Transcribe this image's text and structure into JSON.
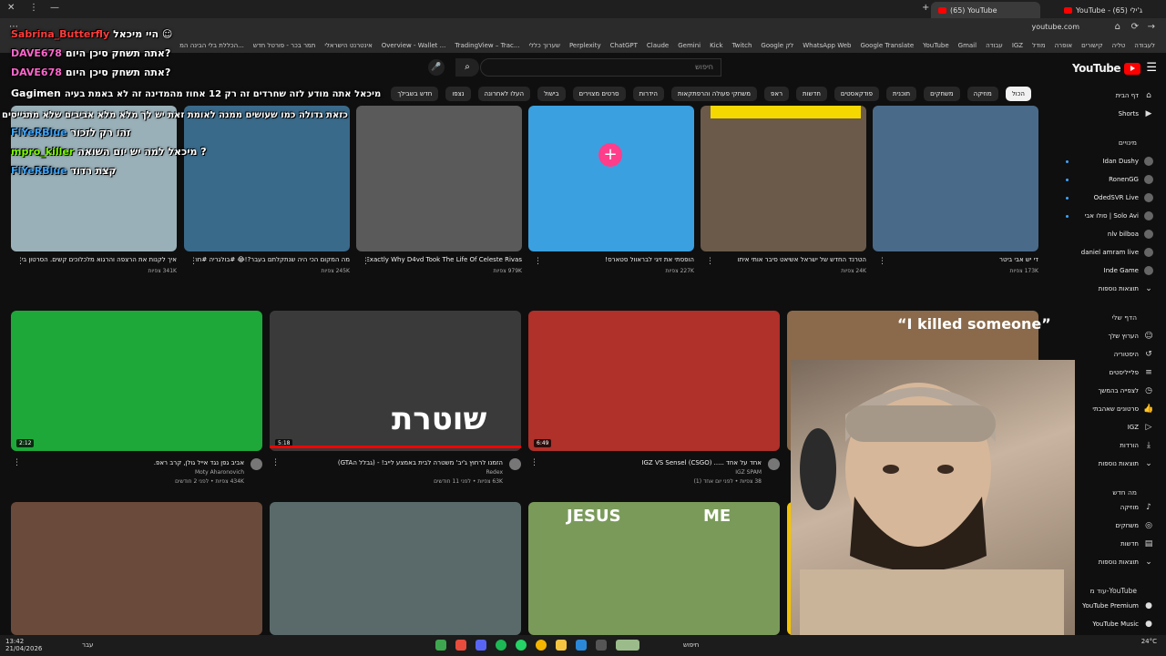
{
  "browser": {
    "tabs": [
      {
        "label": "(65) YouTube",
        "active": true
      },
      {
        "label": "YouTube - (65) ג'ילי",
        "active": false
      }
    ],
    "url": "youtube.com",
    "bookmarks": [
      "לעבודה",
      "טליה",
      "קישורים",
      "אופרה",
      "מודל",
      "IGZ",
      "עבודה",
      "Gmail",
      "YouTube",
      "Google Translate",
      "WhatsApp Web",
      "Google לק",
      "Twitch",
      "Kick",
      "Gemini",
      "Claude",
      "ChatGPT",
      "Perplexity",
      "שערוך כללי",
      "TradingView – Trac...",
      "Overview - Wallet ...",
      "אינטרנט הישראלי",
      "תמר בכר - פורטל חדש",
      "הכללת בלי הבינה המ..."
    ]
  },
  "header": {
    "logo": "YouTube",
    "search_placeholder": "חיפוש"
  },
  "chips": [
    "הכול",
    "מוזיקה",
    "משחקים",
    "תוכנית",
    "פודקאסטים",
    "חדשות",
    "ראפ",
    "משחקי פעולה והרפתקאות",
    "הידרות",
    "סרטים מצוירים",
    "בישול",
    "העלו לאחרונה",
    "נצפו",
    "חדש בשבילך"
  ],
  "sidebar": {
    "home": "דף הבית",
    "shorts": "Shorts",
    "subs_title": "מינויים",
    "subs": [
      "Idan Dushy",
      "RonenGG",
      "OdedSVR Live",
      "Solo Avi | סולו אבי",
      "nlv bilboa",
      "daniel amram live",
      "Inde Game"
    ],
    "show_more": "תוצאות נוספות",
    "you_title": "הדף שלי",
    "you_items": [
      "הערוץ שלך",
      "היסטוריה",
      "פלייליסטים",
      "לצפייה בהמשך",
      "סרטונים שאהבתי",
      "IGZ",
      "הורדות"
    ],
    "show_more2": "תוצאות נוספות",
    "explore_title": "מה חדש",
    "explore_items": [
      "מוזיקה",
      "משחקים",
      "חדשות"
    ],
    "show_more3": "תוצאות נוספות",
    "more_title": "עוד מ-YouTube",
    "more_items": [
      "YouTube Premium",
      "YouTube Music"
    ]
  },
  "videos_row1": [
    {
      "title": "די יש אבי ביטר",
      "meta": "173K צפיות"
    },
    {
      "title": "הטרנד החדש של ישראל אשיאט סיבר אותי איתו",
      "meta": "24K צפיות"
    },
    {
      "title": "הופסתי את זיגי לבראוול סטארס!",
      "meta": "227K צפיות"
    },
    {
      "title": "We Finally Know Exactly Why D4vd Took The Life Of Celeste Rivas",
      "meta": "979K צפיות"
    },
    {
      "title": "מה המקום הכי היה שנתקלתם בעבר?!😂 #בולגריה #חול #טוב bulgaria# #שעארמה",
      "meta": "245K צפיות"
    },
    {
      "title": "איך לקנות את הרצפה והרגוא מלכלוכים קשים. הסרטון בשיתוף #ינקרי #המרקטר #בקיון #מלכודר...",
      "meta": "341K צפיות"
    }
  ],
  "videos_row2": [
    {
      "title": "Murder To Chat GPT",
      "channel": "Out of context Clips",
      "meta": "6.4K צפיות • לפני 9 חודשים",
      "duration": "4:15"
    },
    {
      "title": "אחד על אחד ..... IGZ VS Sensel (CSGO)",
      "channel": "IGZ SPAM",
      "meta": "38 צפיות • לפני יום אחד (1)",
      "duration": "6:49"
    },
    {
      "title": "הזמנו לרחוץ ג'יב' משטרה לבית באמצע לייב! - (גבלל הGTA)",
      "channel": "Redex",
      "meta": "63K צפיות • לפני 11 חודשים",
      "duration": "5:18"
    },
    {
      "title": "אביב גפן נגד אייל גולן, קרב ראפ.",
      "channel": "Moty Aharonovich",
      "meta": "434K צפיות • לפני 2 חודשים",
      "duration": "2:12"
    }
  ],
  "thumb_texts": {
    "killed": "“I killed someone”",
    "shoteret": "שוטרת",
    "jesus": "JESUS",
    "me": "ME"
  },
  "chat": [
    {
      "user": "Sabrina_Butterfly",
      "msg": "היי מיכאל ☺",
      "color": "#ff3b3b"
    },
    {
      "user": "DAVE678",
      "msg": "אתה תשחק סיכן היום?",
      "color": "#ff66cc"
    },
    {
      "user": "DAVE678",
      "msg": "אתה תשחק סיכן היום?",
      "color": "#ff66cc"
    },
    {
      "user": "Gagimen",
      "msg": "מיכאל אתה מודע לזה שחרדים זה רק 12 אחוז מהמדינה זה לא באמת בעיה",
      "color": "#ffffff"
    },
    {
      "user": "",
      "msg": "כזאת גדולה כמו שעושים ממנה לאומת זאת יש לך מלא מלא אביבים שלא מתגייסים",
      "color": "#ffffff"
    },
    {
      "user": "FlYeRBlue",
      "msg": "זהו רק לזכור",
      "color": "#3ea6ff"
    },
    {
      "user": "mpro_killer",
      "msg": "מיכאל למה יש יום השואה ?",
      "color": "#7CFC00"
    },
    {
      "user": "FlYeRBlue",
      "msg": "קצת רדוד",
      "color": "#3ea6ff"
    }
  ],
  "taskbar": {
    "search": "חיפוש",
    "time": "13:42",
    "date": "21/04/2026",
    "temp": "24°C",
    "lang": "עבר"
  }
}
